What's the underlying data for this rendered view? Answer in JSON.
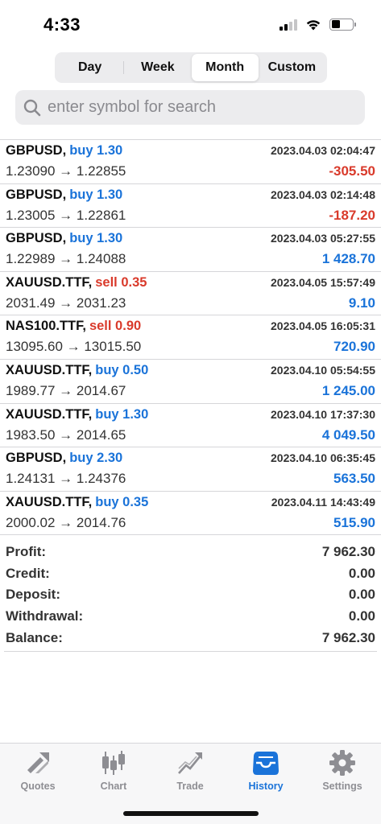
{
  "status_bar": {
    "time": "4:33"
  },
  "tabs": [
    {
      "label": "Day",
      "selected": false
    },
    {
      "label": "Week",
      "selected": false
    },
    {
      "label": "Month",
      "selected": true
    },
    {
      "label": "Custom",
      "selected": false
    }
  ],
  "search": {
    "placeholder": "enter symbol for search",
    "value": ""
  },
  "deals": [
    {
      "symbol": "GBPUSD,",
      "side": "buy 1.30",
      "side_type": "buy",
      "time": "2023.04.03 02:04:47",
      "prices": "1.23090 → 1.22855",
      "profit": "-305.50",
      "profit_sign": "neg"
    },
    {
      "symbol": "GBPUSD,",
      "side": "buy 1.30",
      "side_type": "buy",
      "time": "2023.04.03 02:14:48",
      "prices": "1.23005 → 1.22861",
      "profit": "-187.20",
      "profit_sign": "neg"
    },
    {
      "symbol": "GBPUSD,",
      "side": "buy 1.30",
      "side_type": "buy",
      "time": "2023.04.03 05:27:55",
      "prices": "1.22989 → 1.24088",
      "profit": "1 428.70",
      "profit_sign": "pos"
    },
    {
      "symbol": "XAUUSD.TTF,",
      "side": "sell 0.35",
      "side_type": "sell",
      "time": "2023.04.05 15:57:49",
      "prices": "2031.49 → 2031.23",
      "profit": "9.10",
      "profit_sign": "pos"
    },
    {
      "symbol": "NAS100.TTF,",
      "side": "sell 0.90",
      "side_type": "sell",
      "time": "2023.04.05 16:05:31",
      "prices": "13095.60 → 13015.50",
      "profit": "720.90",
      "profit_sign": "pos"
    },
    {
      "symbol": "XAUUSD.TTF,",
      "side": "buy 0.50",
      "side_type": "buy",
      "time": "2023.04.10 05:54:55",
      "prices": "1989.77 → 2014.67",
      "profit": "1 245.00",
      "profit_sign": "pos"
    },
    {
      "symbol": "XAUUSD.TTF,",
      "side": "buy 1.30",
      "side_type": "buy",
      "time": "2023.04.10 17:37:30",
      "prices": "1983.50 → 2014.65",
      "profit": "4 049.50",
      "profit_sign": "pos"
    },
    {
      "symbol": "GBPUSD,",
      "side": "buy 2.30",
      "side_type": "buy",
      "time": "2023.04.10 06:35:45",
      "prices": "1.24131 → 1.24376",
      "profit": "563.50",
      "profit_sign": "pos"
    },
    {
      "symbol": "XAUUSD.TTF,",
      "side": "buy 0.35",
      "side_type": "buy",
      "time": "2023.04.11 14:43:49",
      "prices": "2000.02 → 2014.76",
      "profit": "515.90",
      "profit_sign": "pos"
    }
  ],
  "summary": [
    {
      "label": "Profit:",
      "value": "7 962.30"
    },
    {
      "label": "Credit:",
      "value": "0.00"
    },
    {
      "label": "Deposit:",
      "value": "0.00"
    },
    {
      "label": "Withdrawal:",
      "value": "0.00"
    },
    {
      "label": "Balance:",
      "value": "7 962.30"
    }
  ],
  "tabbar": [
    {
      "label": "Quotes",
      "icon": "quotes-icon",
      "active": false
    },
    {
      "label": "Chart",
      "icon": "chart-icon",
      "active": false
    },
    {
      "label": "Trade",
      "icon": "trade-icon",
      "active": false
    },
    {
      "label": "History",
      "icon": "history-icon",
      "active": true
    },
    {
      "label": "Settings",
      "icon": "settings-icon",
      "active": false
    }
  ],
  "colors": {
    "accent": "#1a73d9",
    "negative": "#d93a2b",
    "inactive": "#8e8e93"
  }
}
